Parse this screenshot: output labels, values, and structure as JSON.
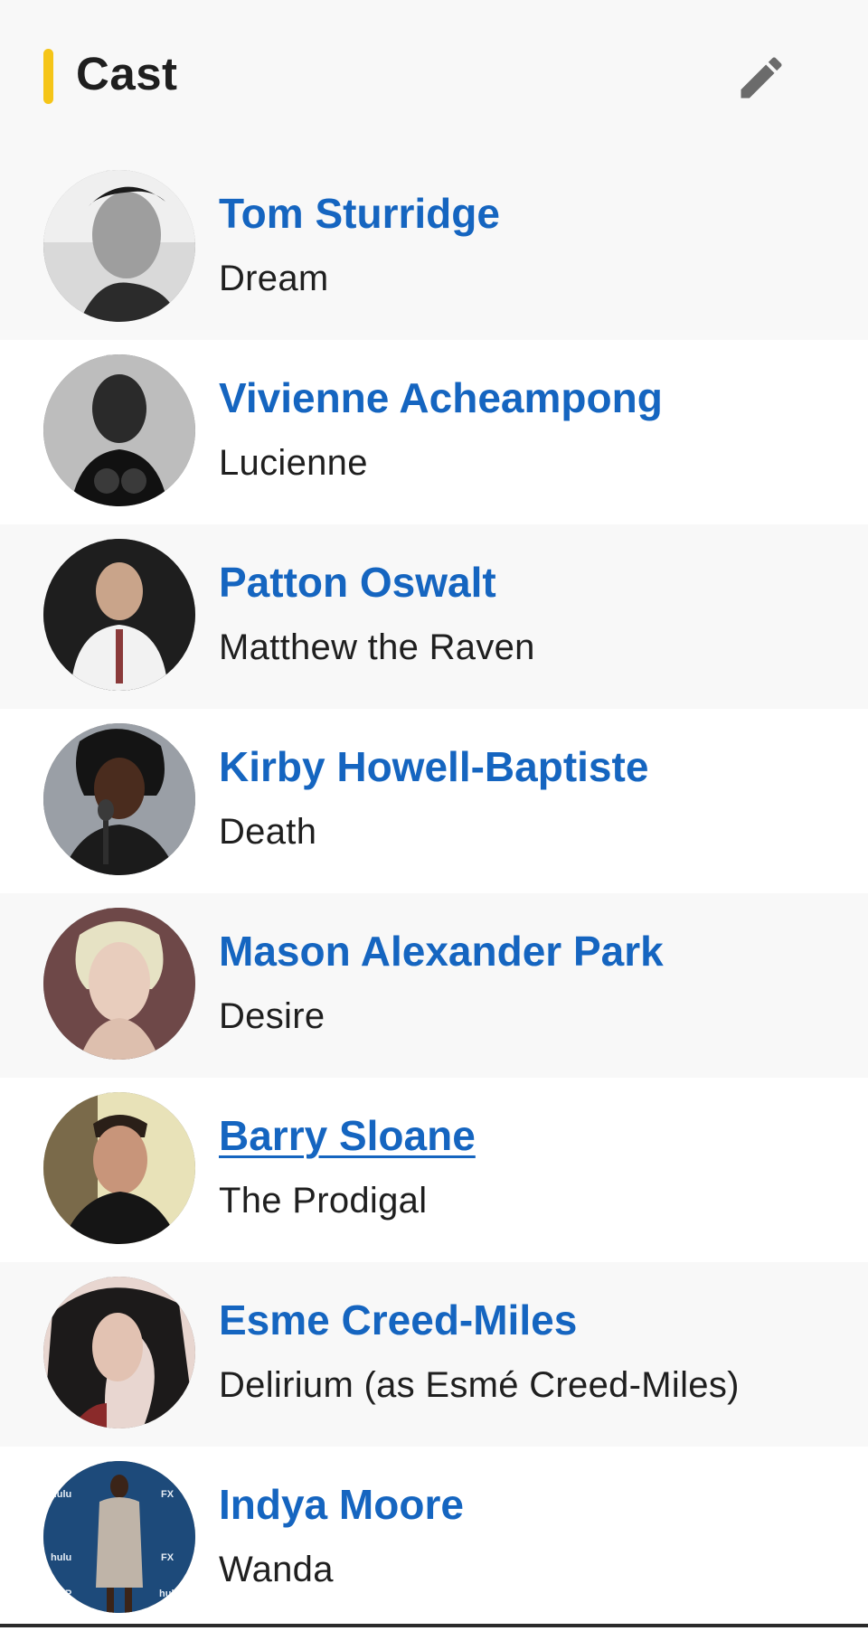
{
  "header": {
    "title": "Cast",
    "accent_color": "#f5c518",
    "edit_icon": "pencil-icon"
  },
  "link_color": "#1565c0",
  "cast": [
    {
      "name": "Tom Sturridge",
      "role": "Dream",
      "photo": "bw-portrait"
    },
    {
      "name": "Vivienne Acheampong",
      "role": "Lucienne",
      "photo": "bw-portrait"
    },
    {
      "name": "Patton Oswalt",
      "role": "Matthew the Raven",
      "photo": "color-portrait"
    },
    {
      "name": "Kirby Howell-Baptiste",
      "role": "Death",
      "photo": "color-portrait"
    },
    {
      "name": "Mason Alexander Park",
      "role": "Desire",
      "photo": "color-portrait"
    },
    {
      "name": "Barry Sloane",
      "role": "The Prodigal",
      "photo": "color-portrait"
    },
    {
      "name": "Esme Creed-Miles",
      "role": "Delirium (as Esmé Creed-Miles)",
      "photo": "color-portrait"
    },
    {
      "name": "Indya Moore",
      "role": "Wanda",
      "photo": "color-portrait"
    }
  ]
}
